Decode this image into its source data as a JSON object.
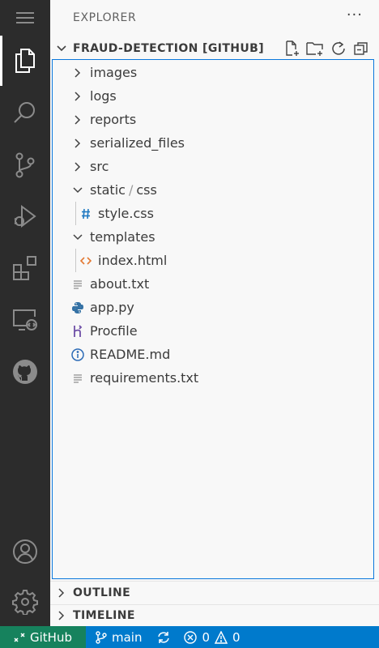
{
  "sidebar": {
    "title": "EXPLORER",
    "more_label": "···",
    "project": {
      "name": "FRAUD-DETECTION [GITHUB]"
    },
    "tree": [
      {
        "label": "images",
        "kind": "folder-closed"
      },
      {
        "label": "logs",
        "kind": "folder-closed"
      },
      {
        "label": "reports",
        "kind": "folder-closed"
      },
      {
        "label": "serialized_files",
        "kind": "folder-closed"
      },
      {
        "label": "src",
        "kind": "folder-closed"
      },
      {
        "label": "static",
        "sep": "/",
        "label2": "css",
        "kind": "folder-open"
      },
      {
        "label": "style.css",
        "kind": "css-file"
      },
      {
        "label": "templates",
        "kind": "folder-open"
      },
      {
        "label": "index.html",
        "kind": "html-file"
      },
      {
        "label": "about.txt",
        "kind": "text-file"
      },
      {
        "label": "app.py",
        "kind": "python-file"
      },
      {
        "label": "Procfile",
        "kind": "heroku-file"
      },
      {
        "label": "README.md",
        "kind": "info-file"
      },
      {
        "label": "requirements.txt",
        "kind": "text-file"
      }
    ],
    "outline_label": "OUTLINE",
    "timeline_label": "TIMELINE"
  },
  "statusbar": {
    "remote_label": "GitHub",
    "branch": "main",
    "errors": "0",
    "warnings": "0"
  },
  "colors": {
    "activity_bar": "#2c2c2c",
    "sidebar_bg": "#f8f8f8",
    "focus_border": "#0a77dc",
    "statusbar": "#007acc",
    "remote": "#16825d"
  }
}
